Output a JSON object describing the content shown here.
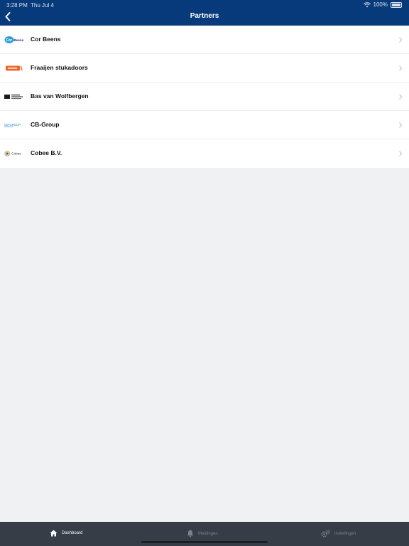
{
  "status_bar": {
    "time": "3:28 PM",
    "date": "Thu Jul 4",
    "battery": "100%"
  },
  "header": {
    "title": "Partners",
    "background": "#073a7a"
  },
  "partners": [
    {
      "name": "Cor Beens",
      "logo_icon": "cor-beens-logo",
      "logo_text": "Beens"
    },
    {
      "name": "Fraaijen stukadoors",
      "logo_icon": "fraaijen-logo",
      "logo_text": ""
    },
    {
      "name": "Bas van Wolfbergen",
      "logo_icon": "bas-van-wolfbergen-logo",
      "logo_text": ""
    },
    {
      "name": "CB-Group",
      "logo_icon": "cb-group-logo",
      "logo_text": "CB-GROUP"
    },
    {
      "name": "Cobee B.V.",
      "logo_icon": "cobee-logo",
      "logo_text": "Cobee"
    }
  ],
  "tab_bar": {
    "tabs": [
      {
        "label": "Dashboard",
        "icon": "home-icon",
        "active": true
      },
      {
        "label": "Meldingen",
        "icon": "bell-icon",
        "active": false
      },
      {
        "label": "Instellingen",
        "icon": "gears-icon",
        "active": false
      }
    ],
    "background": "#363d46"
  }
}
